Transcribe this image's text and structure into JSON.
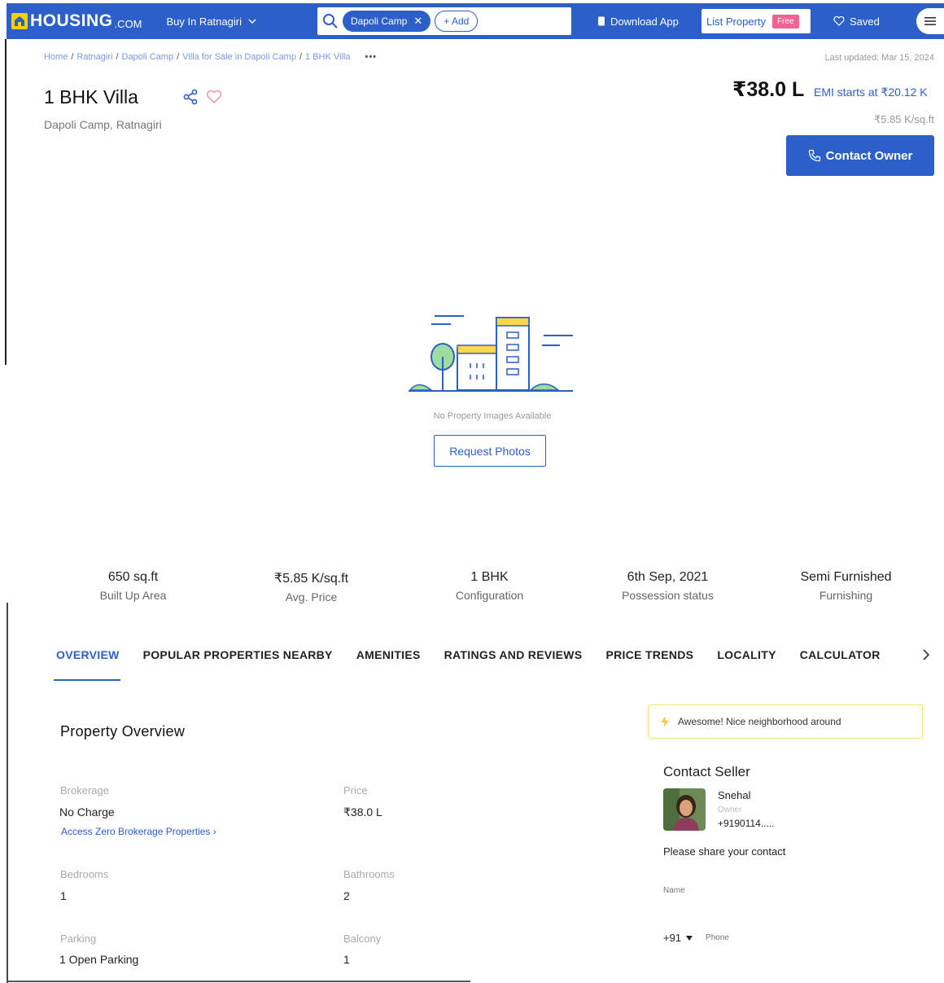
{
  "header": {
    "logo_text": "HOUSING",
    "logo_sub": ".COM",
    "city": "Buy In Ratnagiri",
    "search_chip": "Dapoli Camp",
    "search_chip_close": "✕",
    "add_chip": "+ Add",
    "download_app": "Download App",
    "list_property": "List Property",
    "free_badge": "Free",
    "saved": "Saved",
    "brand_color": "#2d5fc9"
  },
  "breadcrumb": {
    "items": [
      "Home",
      "Ratnagiri",
      "Dapoli Camp",
      "Villa for Sale in Dapoli Camp",
      "1 BHK Villa"
    ],
    "separator": "/",
    "more": "•••",
    "last_updated": "Last updated: Mar 15, 2024"
  },
  "property": {
    "title": "1 BHK Villa",
    "location": "Dapoli Camp, Ratnagiri",
    "price": "₹38.0 L",
    "emi": "EMI starts at ₹20.12 K",
    "price_per_sqft": "₹5.85 K/sq.ft",
    "contact_button": "Contact Owner"
  },
  "placeholder": {
    "no_images": "No Property Images Available",
    "request_photos": "Request Photos"
  },
  "stats": [
    {
      "value": "650 sq.ft",
      "label": "Built Up Area"
    },
    {
      "value": "₹5.85 K/sq.ft",
      "label": "Avg. Price"
    },
    {
      "value": "1 BHK",
      "label": "Configuration"
    },
    {
      "value": "6th Sep, 2021",
      "label": "Possession status"
    },
    {
      "value": "Semi Furnished",
      "label": "Furnishing"
    }
  ],
  "tabs": [
    "OVERVIEW",
    "POPULAR PROPERTIES NEARBY",
    "AMENITIES",
    "RATINGS AND REVIEWS",
    "PRICE TRENDS",
    "LOCALITY",
    "CALCULATOR"
  ],
  "overview": {
    "title": "Property Overview",
    "brokerage_label": "Brokerage",
    "brokerage_value": "No Charge",
    "brokerage_link": "Access Zero Brokerage Properties ›",
    "price_label": "Price",
    "price_value": "₹38.0 L",
    "bedrooms_label": "Bedrooms",
    "bedrooms_value": "1",
    "bathrooms_label": "Bathrooms",
    "bathrooms_value": "2",
    "parking_label": "Parking",
    "parking_value": "1 Open Parking",
    "balcony_label": "Balcony",
    "balcony_value": "1"
  },
  "seller": {
    "neighborhood_note": "Awesome! Nice neighborhood around",
    "title": "Contact Seller",
    "name": "Snehal",
    "role": "Owner",
    "phone": "+9190114.....",
    "share_contact": "Please share your contact",
    "name_placeholder": "Name",
    "country_code": "+91",
    "phone_placeholder": "Phone"
  }
}
